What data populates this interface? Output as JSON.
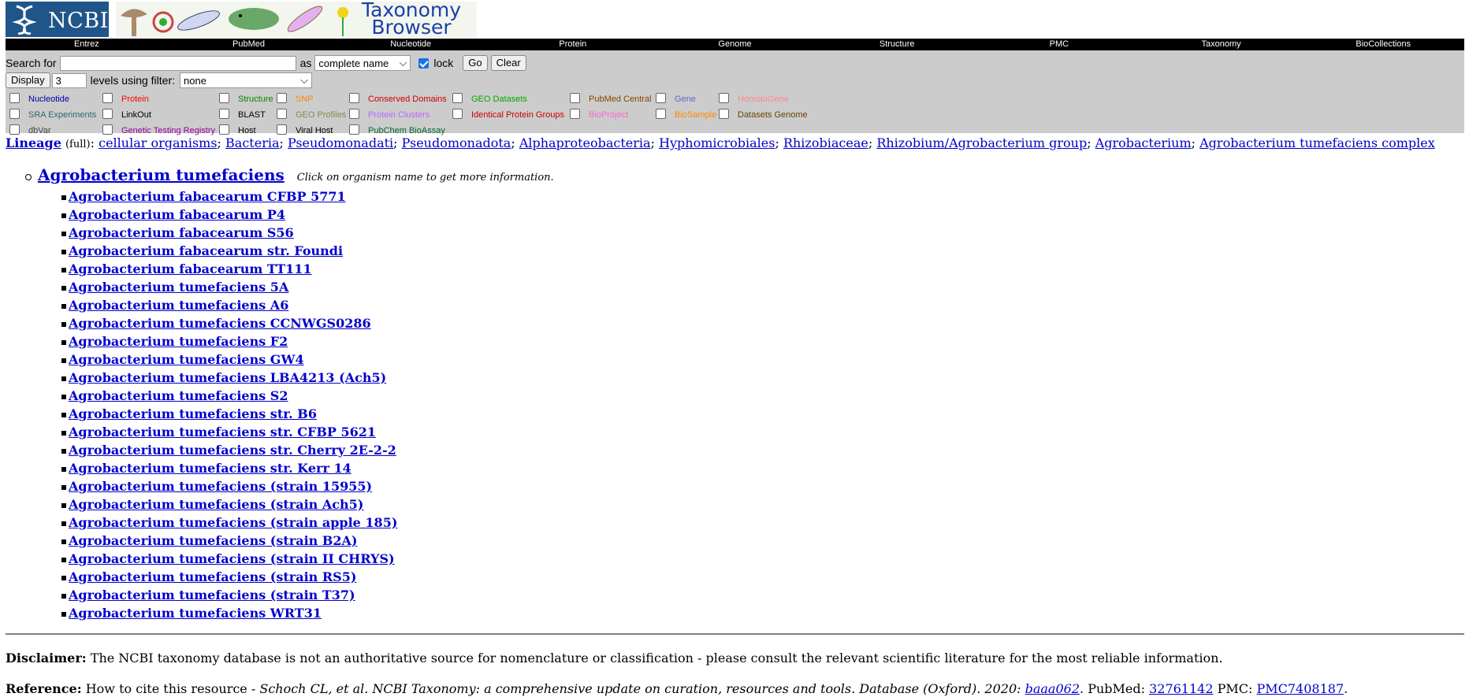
{
  "header": {
    "logo_text": "NCBI",
    "banner_title_line1": "Taxonomy",
    "banner_title_line2": "Browser"
  },
  "nav": [
    "Entrez",
    "PubMed",
    "Nucleotide",
    "Protein",
    "Genome",
    "Structure",
    "PMC",
    "Taxonomy",
    "BioCollections"
  ],
  "search": {
    "label": "Search for",
    "value": "",
    "as_label": "as",
    "as_selected": "complete name",
    "lock_label": "lock",
    "lock_checked": true,
    "go_label": "Go",
    "clear_label": "Clear",
    "display_label": "Display",
    "levels_value": "3",
    "levels_label": "levels using filter:",
    "filter_selected": "none"
  },
  "filters": [
    {
      "label": "Nucleotide",
      "color": "#0000aa"
    },
    {
      "label": "Protein",
      "color": "#ff0000"
    },
    {
      "label": "Structure",
      "color": "#008800"
    },
    {
      "label": "SNP",
      "color": "#ff8800"
    },
    {
      "label": "Conserved Domains",
      "color": "#cc0000"
    },
    {
      "label": "GEO Datasets",
      "color": "#00aa00"
    },
    {
      "label": "PubMed Central",
      "color": "#884400"
    },
    {
      "label": "Gene",
      "color": "#6666cc"
    },
    {
      "label": "HomoloGene",
      "color": "#ff8888"
    },
    {
      "label": "SRA Experiments",
      "color": "#336666"
    },
    {
      "label": "LinkOut",
      "color": "#000000"
    },
    {
      "label": "BLAST",
      "color": "#000000"
    },
    {
      "label": "GEO Profiles",
      "color": "#888855"
    },
    {
      "label": "Protein Clusters",
      "color": "#bb66ff"
    },
    {
      "label": "Identical Protein Groups",
      "color": "#cc0000"
    },
    {
      "label": "BioProject",
      "color": "#ff66cc"
    },
    {
      "label": "BioSample",
      "color": "#ff8800"
    },
    {
      "label": "Datasets Genome",
      "color": "#664400"
    },
    {
      "label": "dbVar",
      "color": "#444444"
    },
    {
      "label": "Genetic Testing Registry",
      "color": "#990099"
    },
    {
      "label": "Host",
      "color": "#000000"
    },
    {
      "label": "Viral Host",
      "color": "#000000"
    },
    {
      "label": "PubChem BioAssay",
      "color": "#006633"
    }
  ],
  "lineage": {
    "label": "Lineage",
    "full": "(full)",
    "items": [
      "cellular organisms",
      "Bacteria",
      "Pseudomonadati",
      "Pseudomonadota",
      "Alphaproteobacteria",
      "Hyphomicrobiales",
      "Rhizobiaceae",
      "Rhizobium/Agrobacterium group",
      "Agrobacterium",
      "Agrobacterium tumefaciens complex"
    ]
  },
  "taxon": {
    "name": "Agrobacterium tumefaciens",
    "hint": "Click on organism name to get more information.",
    "children": [
      "Agrobacterium fabacearum CFBP 5771",
      "Agrobacterium fabacearum P4",
      "Agrobacterium fabacearum S56",
      "Agrobacterium fabacearum str. Foundi",
      "Agrobacterium fabacearum TT111",
      "Agrobacterium tumefaciens 5A",
      "Agrobacterium tumefaciens A6",
      "Agrobacterium tumefaciens CCNWGS0286",
      "Agrobacterium tumefaciens F2",
      "Agrobacterium tumefaciens GW4",
      "Agrobacterium tumefaciens LBA4213 (Ach5)",
      "Agrobacterium tumefaciens S2",
      "Agrobacterium tumefaciens str. B6",
      "Agrobacterium tumefaciens str. CFBP 5621",
      "Agrobacterium tumefaciens str. Cherry 2E-2-2",
      "Agrobacterium tumefaciens str. Kerr 14",
      "Agrobacterium tumefaciens (strain 15955)",
      "Agrobacterium tumefaciens (strain Ach5)",
      "Agrobacterium tumefaciens (strain apple 185)",
      "Agrobacterium tumefaciens (strain B2A)",
      "Agrobacterium tumefaciens (strain II CHRYS)",
      "Agrobacterium tumefaciens (strain RS5)",
      "Agrobacterium tumefaciens (strain T37)",
      "Agrobacterium tumefaciens WRT31"
    ]
  },
  "disclaimer": {
    "label": "Disclaimer:",
    "text": "The NCBI taxonomy database is not an authoritative source for nomenclature or classification - please consult the relevant scientific literature for the most reliable information."
  },
  "reference": {
    "label": "Reference:",
    "text": "How to cite this resource - ",
    "citation": "Schoch CL, et al. NCBI Taxonomy: a comprehensive update on curation, resources and tools. Database (Oxford). 2020: ",
    "doi": "baaa062",
    "after_doi": ". PubMed: ",
    "pubmed": "32761142",
    "pmc_label": " PMC: ",
    "pmc": "PMC7408187",
    "end": "."
  }
}
